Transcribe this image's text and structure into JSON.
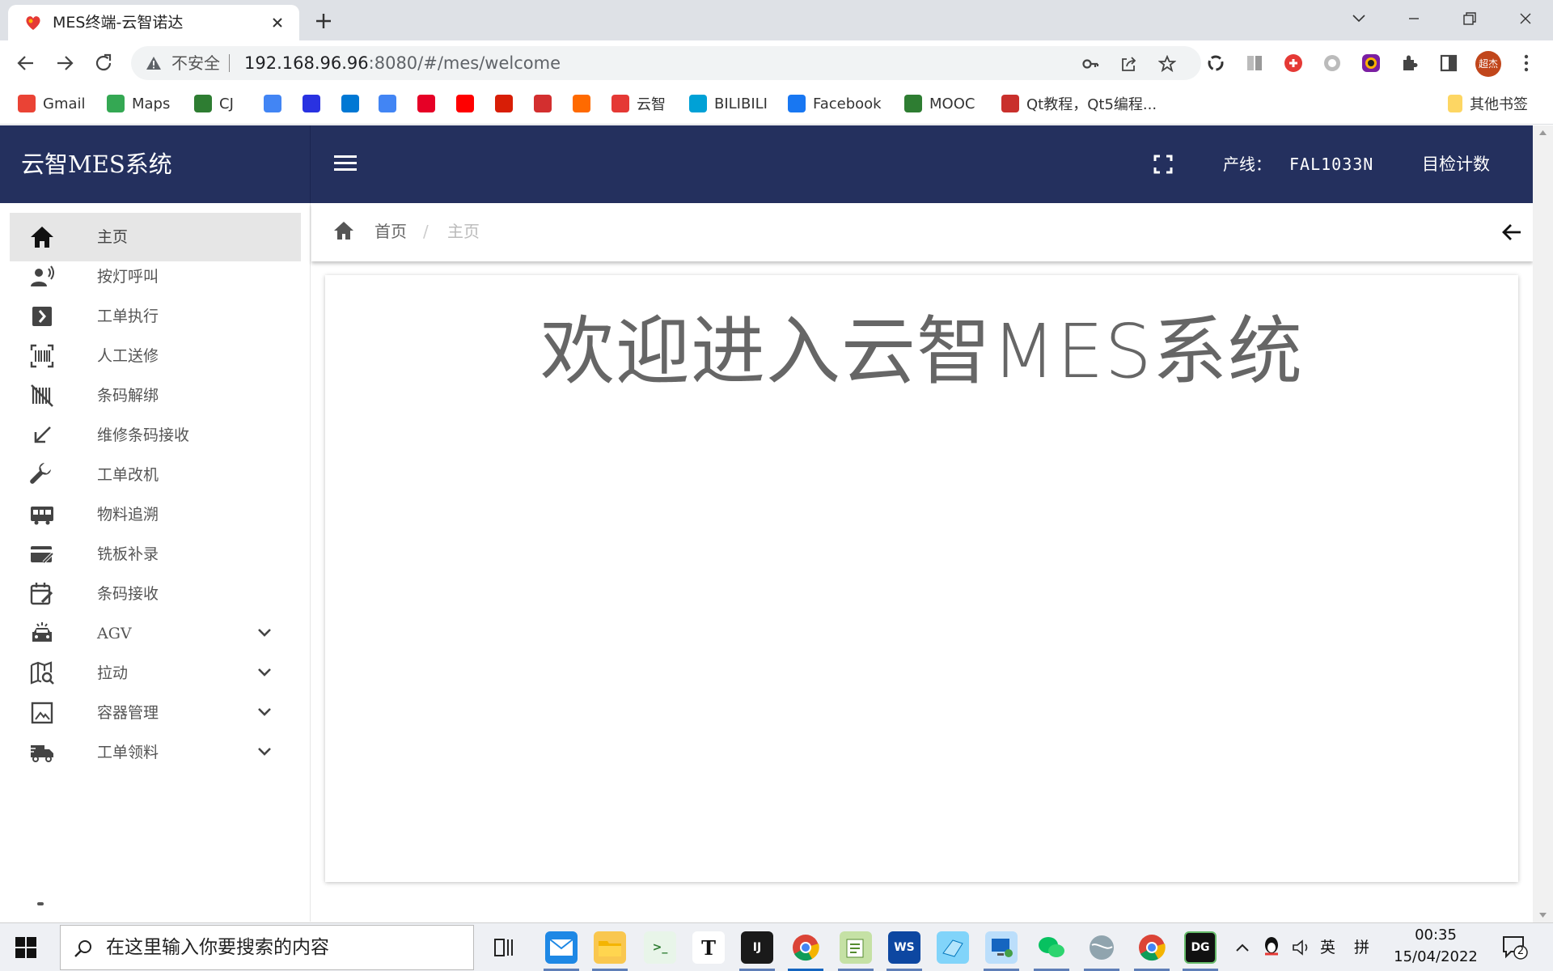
{
  "browser": {
    "tab_title": "MES终端-云智诺达",
    "address_insecure_label": "不安全",
    "url_host": "192.168.96.96",
    "url_rest": ":8080/#/mes/welcome",
    "profile_label": "超杰",
    "bookmarks": [
      {
        "label": "Gmail",
        "icon": "gmail-icon",
        "color": "#ea4335"
      },
      {
        "label": "Maps",
        "icon": "maps-icon",
        "color": "#34a853"
      },
      {
        "label": "CJ",
        "icon": "globe-icon",
        "color": "#2e7d32"
      },
      {
        "label": "",
        "icon": "google-icon",
        "color": "#4285f4"
      },
      {
        "label": "",
        "icon": "baidu-icon",
        "color": "#2932e1"
      },
      {
        "label": "",
        "icon": "bing-icon",
        "color": "#0078d4"
      },
      {
        "label": "",
        "icon": "translate-icon",
        "color": "#4285f4"
      },
      {
        "label": "",
        "icon": "netease-music-icon",
        "color": "#e60026"
      },
      {
        "label": "",
        "icon": "youtube-icon",
        "color": "#ff0000"
      },
      {
        "label": "",
        "icon": "netease-icon",
        "color": "#d81e06"
      },
      {
        "label": "",
        "icon": "mail-m-icon",
        "color": "#d32f2f"
      },
      {
        "label": "",
        "icon": "alibaba-icon",
        "color": "#ff6a00"
      },
      {
        "label": "云智",
        "icon": "yunzhi-icon",
        "color": "#e53935"
      },
      {
        "label": "BILIBILI",
        "icon": "bilibili-icon",
        "color": "#00a1d6"
      },
      {
        "label": "Facebook",
        "icon": "facebook-icon",
        "color": "#1877f2"
      },
      {
        "label": "MOOC",
        "icon": "mooc-icon",
        "color": "#2e7d32"
      },
      {
        "label": "Qt教程，Qt5编程...",
        "icon": "csdn-icon",
        "color": "#c9302c"
      }
    ],
    "other_bookmarks": "其他书签"
  },
  "app": {
    "brand": "云智MES系统",
    "line_label": "产线：",
    "line_value": "FAL1033N",
    "self_check": "目检计数",
    "breadcrumb": {
      "home": "首页",
      "separator": "/",
      "current": "主页"
    },
    "welcome": "欢迎进入云智MES系统",
    "menu": [
      {
        "label": "主页",
        "icon": "home-icon",
        "active": true,
        "expandable": false
      },
      {
        "label": "按灯呼叫",
        "icon": "call-speaker-icon",
        "active": false,
        "expandable": false
      },
      {
        "label": "工单执行",
        "icon": "chevron-box-icon",
        "active": false,
        "expandable": false
      },
      {
        "label": "人工送修",
        "icon": "barcode-scan-icon",
        "active": false,
        "expandable": false
      },
      {
        "label": "条码解绑",
        "icon": "barcode-off-icon",
        "active": false,
        "expandable": false
      },
      {
        "label": "维修条码接收",
        "icon": "arrow-down-left-icon",
        "active": false,
        "expandable": false
      },
      {
        "label": "工单改机",
        "icon": "wrench-icon",
        "active": false,
        "expandable": false
      },
      {
        "label": "物料追溯",
        "icon": "bus-icon",
        "active": false,
        "expandable": false
      },
      {
        "label": "铣板补录",
        "icon": "card-edit-icon",
        "active": false,
        "expandable": false
      },
      {
        "label": "条码接收",
        "icon": "calendar-edit-icon",
        "active": false,
        "expandable": false
      },
      {
        "label": "AGV",
        "icon": "car-icon",
        "active": false,
        "expandable": true
      },
      {
        "label": "拉动",
        "icon": "map-search-icon",
        "active": false,
        "expandable": true
      },
      {
        "label": "容器管理",
        "icon": "image-frame-icon",
        "active": false,
        "expandable": true
      },
      {
        "label": "工单领料",
        "icon": "truck-icon",
        "active": false,
        "expandable": true
      }
    ]
  },
  "taskbar": {
    "search_placeholder": "在这里输入你要搜索的内容",
    "ime_lang": "英",
    "ime_mode": "拼",
    "time": "00:35",
    "date": "15/04/2022",
    "notifications": "2"
  },
  "colors": {
    "header_bg": "#24305e",
    "active_menu_bg": "#e6e6e6",
    "welcome_text": "#666666"
  }
}
